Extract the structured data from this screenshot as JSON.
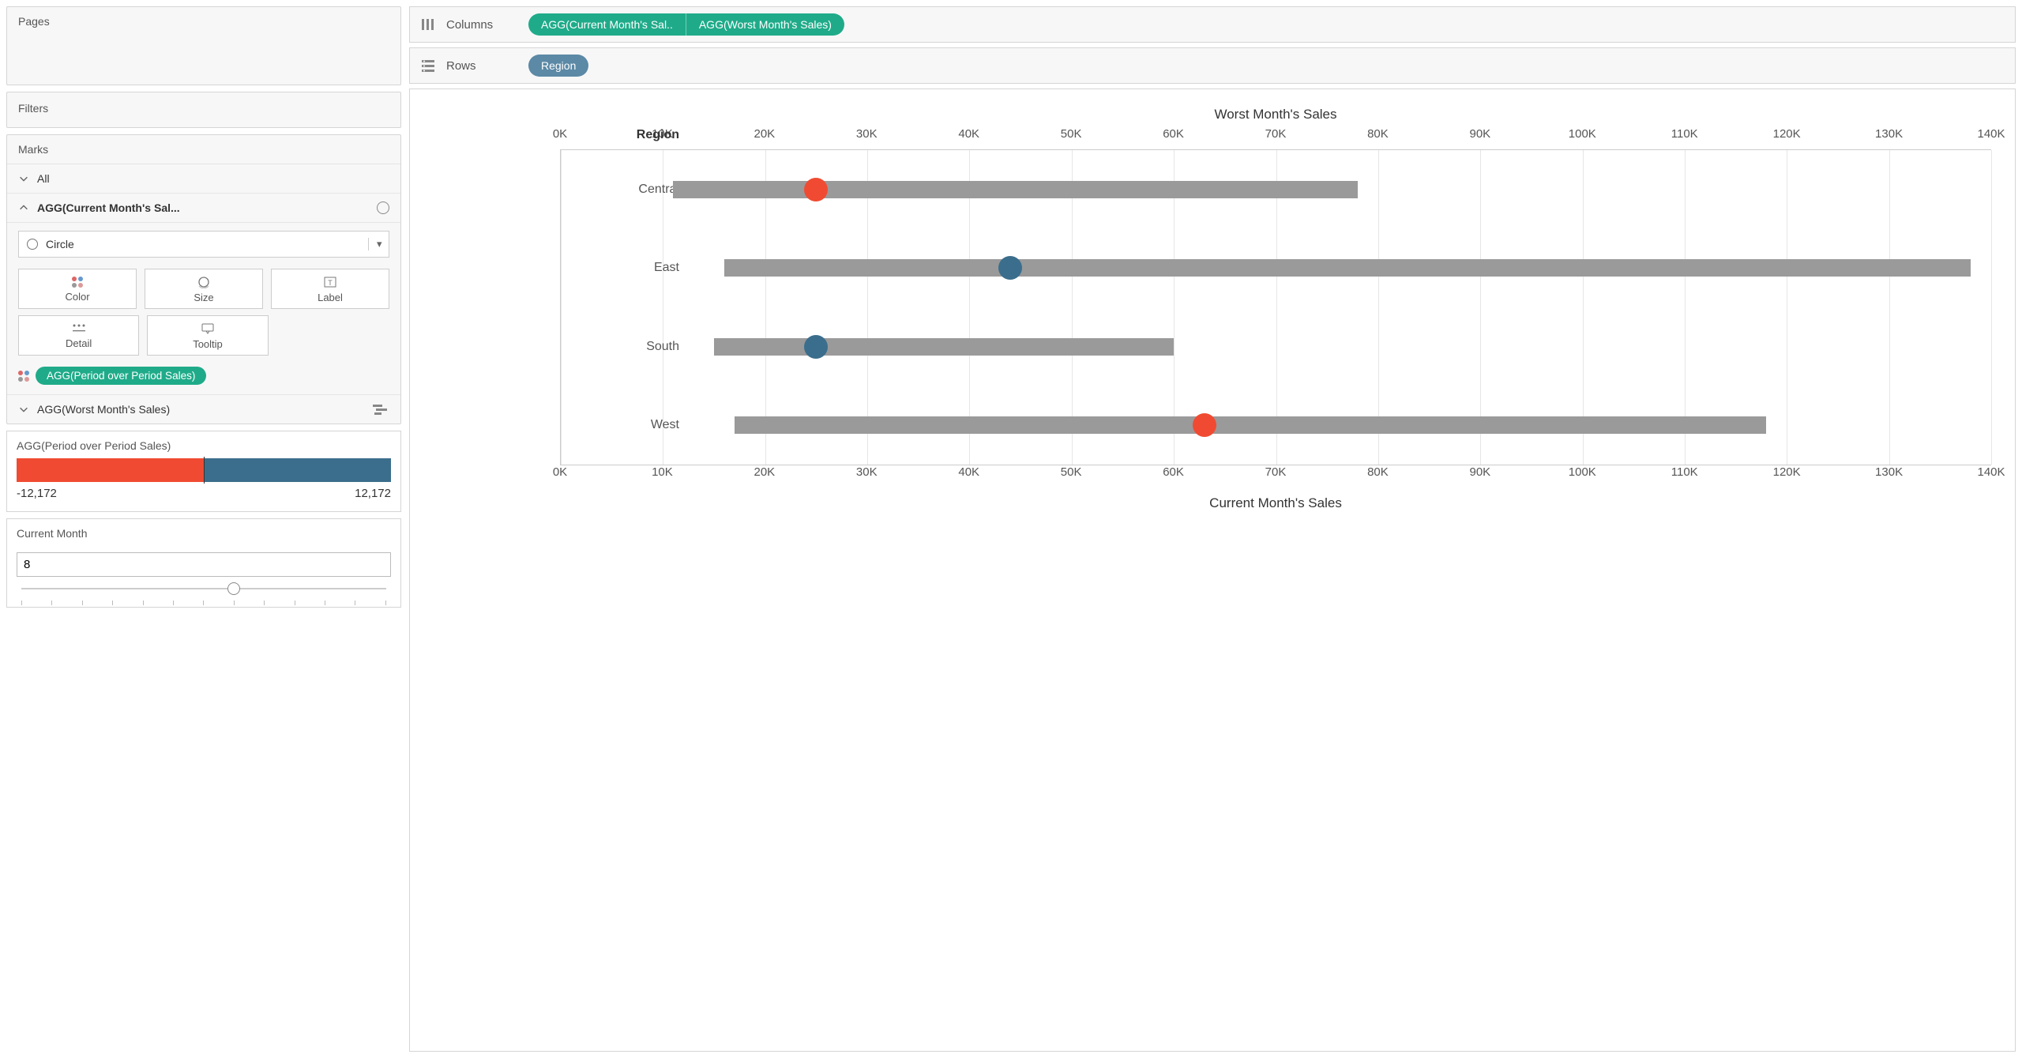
{
  "sidebar": {
    "pages_label": "Pages",
    "filters_label": "Filters",
    "marks_label": "Marks",
    "marks_all": "All",
    "marks_card1": "AGG(Current Month's Sal...",
    "marks_card2": "AGG(Worst Month's Sales)",
    "mark_type": "Circle",
    "cells": {
      "color": "Color",
      "size": "Size",
      "label": "Label",
      "detail": "Detail",
      "tooltip": "Tooltip"
    },
    "color_pill": "AGG(Period over Period Sales)"
  },
  "legend": {
    "title": "AGG(Period over Period Sales)",
    "min": "-12,172",
    "max": "12,172",
    "colors": {
      "neg": "#f04b32",
      "pos": "#3b6e8c"
    }
  },
  "param": {
    "title": "Current Month",
    "value": "8",
    "slider_pos_pct": 58
  },
  "shelves": {
    "columns_label": "Columns",
    "rows_label": "Rows",
    "col_pill1": "AGG(Current Month's Sal..",
    "col_pill2": "AGG(Worst Month's Sales)",
    "row_pill": "Region"
  },
  "chart_data": {
    "type": "bar",
    "title_top": "Worst Month's Sales",
    "title_bottom": "Current Month's Sales",
    "ylabel": "Region",
    "xlim": [
      0,
      140000
    ],
    "ticks": [
      "0K",
      "10K",
      "20K",
      "30K",
      "40K",
      "50K",
      "60K",
      "70K",
      "80K",
      "90K",
      "100K",
      "110K",
      "120K",
      "130K",
      "140K"
    ],
    "categories": [
      "Central",
      "East",
      "South",
      "West"
    ],
    "series": [
      {
        "name": "Worst Month's Sales (bar start)",
        "role": "bar_start",
        "values": [
          11000,
          16000,
          15000,
          17000
        ]
      },
      {
        "name": "Worst Month's Sales (bar end)",
        "role": "bar_end",
        "values": [
          78000,
          138000,
          60000,
          118000
        ]
      },
      {
        "name": "Current Month's Sales (dot)",
        "role": "dot",
        "values": [
          25000,
          44000,
          25000,
          63000
        ]
      },
      {
        "name": "Period over Period Sales (dot color)",
        "role": "dot_color",
        "values": [
          "neg",
          "pos",
          "pos",
          "neg"
        ]
      }
    ]
  }
}
